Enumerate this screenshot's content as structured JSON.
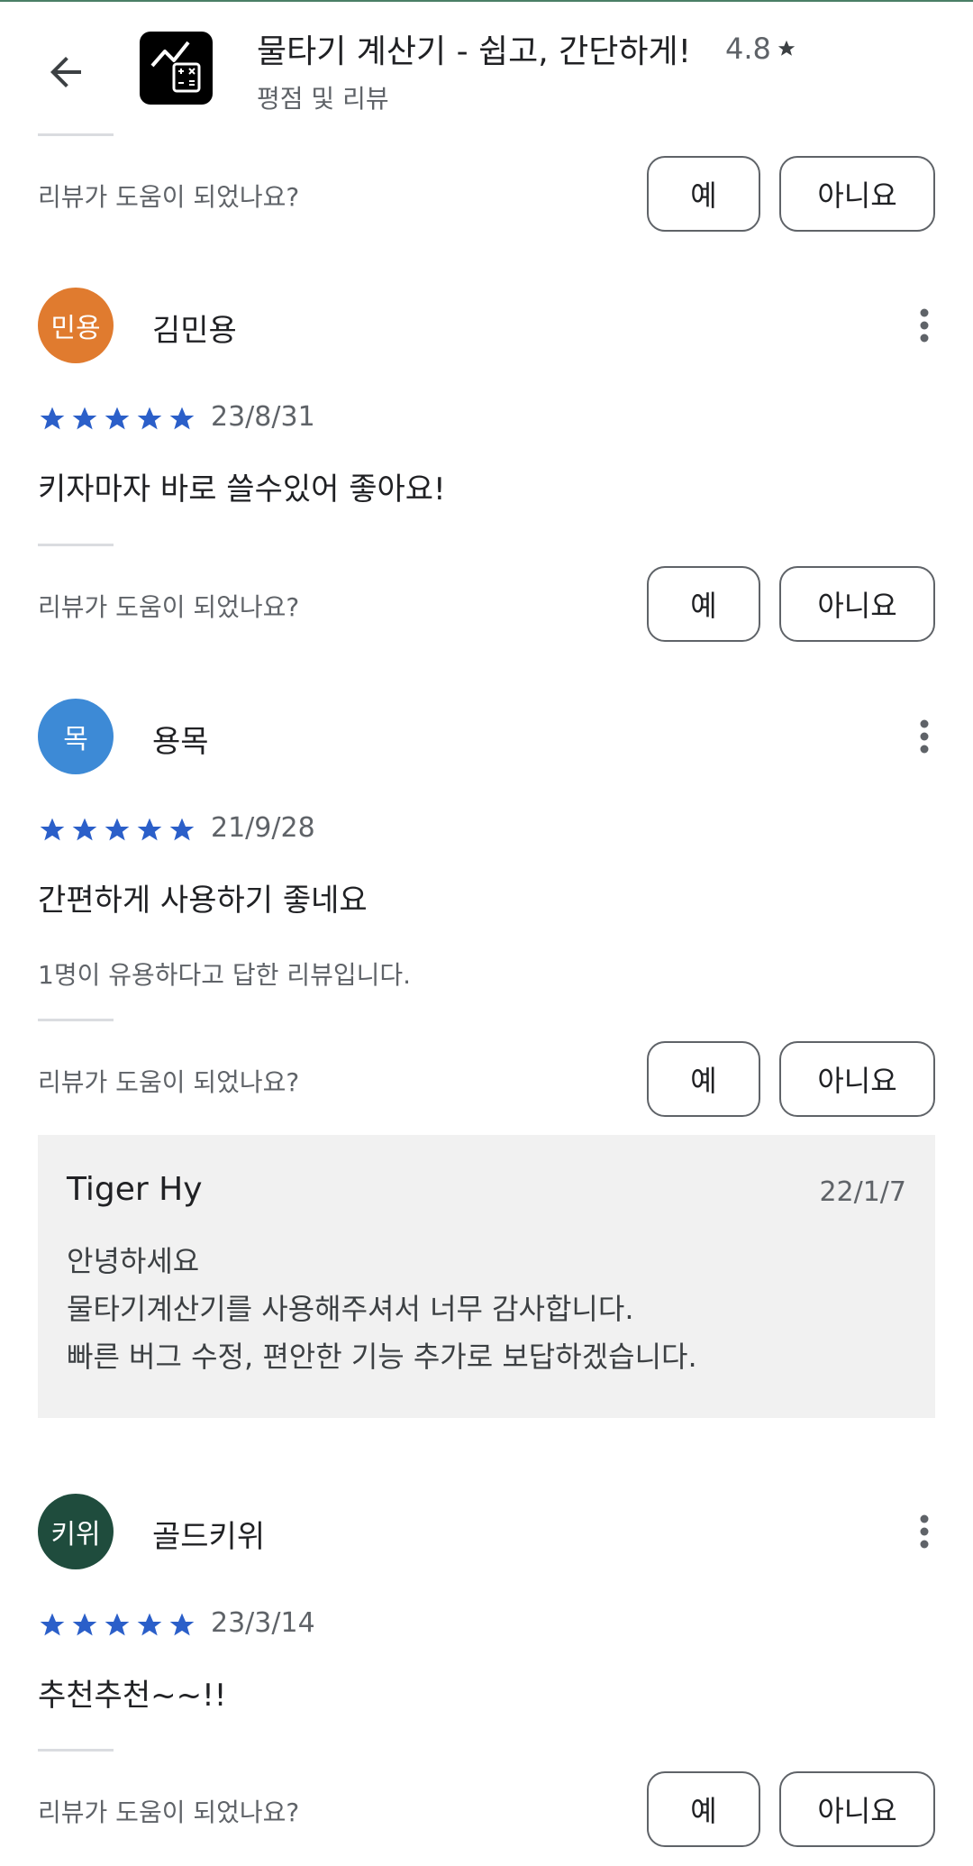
{
  "header": {
    "app_title": "물타기 계산기 - 쉽고, 간단하게!",
    "app_rating": "4.8",
    "subtitle": "평점 및 리뷰"
  },
  "helpful": {
    "question": "리뷰가 도움이 되었나요?",
    "yes_label": "예",
    "no_label": "아니요"
  },
  "reviews": [
    {
      "avatar_text": "민용",
      "avatar_color": "#e07b2f",
      "name": "김민용",
      "stars": 5,
      "date": "23/8/31",
      "text": "키자마자 바로 쓸수있어 좋아요!"
    },
    {
      "avatar_text": "목",
      "avatar_color": "#3d8ad6",
      "name": "용목",
      "stars": 5,
      "date": "21/9/28",
      "text": "간편하게 사용하기 좋네요",
      "helpful_count": "1명이 유용하다고 답한 리뷰입니다."
    },
    {
      "avatar_text": "키위",
      "avatar_color": "#1f4c3d",
      "name": "골드키위",
      "stars": 5,
      "date": "23/3/14",
      "text": "추천추천~~!!"
    }
  ],
  "developer_reply": {
    "name": "Tiger Hy",
    "date": "22/1/7",
    "lines": [
      "안녕하세요",
      "물타기계산기를 사용해주셔서 너무 감사합니다.",
      "빠른 버그 수정, 편안한 기능 추가로 보답하겠습니다."
    ]
  },
  "colors": {
    "star": "#2b5fc9",
    "text_secondary": "#5f6368",
    "reply_bg": "#f1f1f1"
  }
}
